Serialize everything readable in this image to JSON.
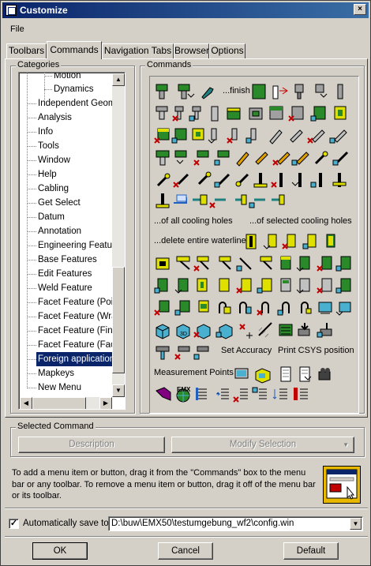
{
  "window": {
    "title": "Customize",
    "close_label": "×"
  },
  "menu": {
    "file": "File"
  },
  "tabs": [
    {
      "label": "Toolbars"
    },
    {
      "label": "Commands",
      "active": true
    },
    {
      "label": "Navigation Tabs"
    },
    {
      "label": "Browser"
    },
    {
      "label": "Options"
    }
  ],
  "categories": {
    "label": "Categories",
    "items": [
      {
        "label": "Motion",
        "level": 2
      },
      {
        "label": "Dynamics",
        "level": 2
      },
      {
        "label": "Independent Geome",
        "level": 1
      },
      {
        "label": "Analysis",
        "level": 1
      },
      {
        "label": "Info",
        "level": 1
      },
      {
        "label": "Tools",
        "level": 1
      },
      {
        "label": "Window",
        "level": 1
      },
      {
        "label": "Help",
        "level": 1
      },
      {
        "label": "Cabling",
        "level": 1
      },
      {
        "label": "Get Select",
        "level": 1
      },
      {
        "label": "Datum",
        "level": 1
      },
      {
        "label": "Annotation",
        "level": 1
      },
      {
        "label": "Engineering Feature",
        "level": 1
      },
      {
        "label": "Base Features",
        "level": 1
      },
      {
        "label": "Edit Features",
        "level": 1
      },
      {
        "label": "Weld Feature",
        "level": 1
      },
      {
        "label": "Facet Feature (Poin",
        "level": 1
      },
      {
        "label": "Facet Feature (Wra",
        "level": 1
      },
      {
        "label": "Facet Feature (Fine",
        "level": 1
      },
      {
        "label": "Facet Feature (Face",
        "level": 1
      },
      {
        "label": "Foreign applications",
        "level": 1,
        "selected": true
      },
      {
        "label": "Mapkeys",
        "level": 1
      },
      {
        "label": "New Menu",
        "level": 1
      }
    ]
  },
  "commands": {
    "label": "Commands",
    "texts": {
      "finish": "...finish",
      "all_cooling": "...of all cooling holes",
      "selected_cooling": "...of selected cooling holes",
      "delete_waterline": "...delete entire waterline",
      "set_accuracy": "Set Accuracy",
      "print_csys": "Print CSYS position",
      "measurement_points": "Measurement Points",
      "emx": "EMX"
    }
  },
  "selected_command": {
    "label": "Selected Command",
    "description_button": "Description",
    "modify_button": "Modify Selection",
    "modify_arrow": "▼"
  },
  "hint": {
    "text": "To add a menu item or button, drag it from the \"Commands\" box to the menu bar or any toolbar.  To remove a menu item or button, drag it off of the menu bar or its toolbar."
  },
  "autosave": {
    "checked_mark": "✓",
    "label": "Automatically save to",
    "path": "D:\\buw\\EMX50\\testumgebung_wf2\\config.win",
    "arrow": "▼"
  },
  "footer": {
    "ok": "OK",
    "cancel": "Cancel",
    "default": "Default"
  },
  "colors": {
    "title_start": "#0a246a",
    "title_end": "#3a6ea5",
    "face": "#d4d0c8",
    "selection": "#0a246a"
  }
}
